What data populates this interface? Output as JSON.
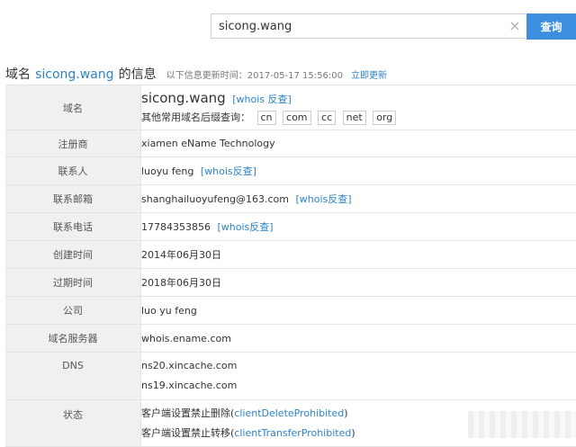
{
  "search": {
    "value": "sicong.wang",
    "clear_icon": "×",
    "button_label": "查询"
  },
  "heading": {
    "prefix": "域名",
    "domain": "sicong.wang",
    "suffix": "的信息",
    "note": "以下信息更新时间：2017-05-17 15:56:00",
    "update_link": "立即更新"
  },
  "rows": {
    "domain": {
      "label": "域名",
      "value": "sicong.wang",
      "link": "[whois 反查]",
      "suffix_prompt": "其他常用域名后缀查询：",
      "suffixes": [
        "cn",
        "com",
        "cc",
        "net",
        "org"
      ]
    },
    "registrar": {
      "label": "注册商",
      "value": "xiamen eName Technology"
    },
    "contact": {
      "label": "联系人",
      "value": "luoyu feng",
      "link": "[whois反查]"
    },
    "email": {
      "label": "联系邮箱",
      "value": "shanghailuoyufeng@163.com",
      "link": "[whois反查]"
    },
    "phone": {
      "label": "联系电话",
      "value": "17784353856",
      "link": "[whois反查]"
    },
    "created": {
      "label": "创建时间",
      "value": "2014年06月30日"
    },
    "expires": {
      "label": "过期时间",
      "value": "2018年06月30日"
    },
    "company": {
      "label": "公司",
      "value": "luo yu feng"
    },
    "nameserver": {
      "label": "域名服务器",
      "value": "whois.ename.com"
    },
    "dns": {
      "label": "DNS",
      "values": [
        "ns20.xincache.com",
        "ns19.xincache.com"
      ]
    },
    "status": {
      "label": "状态",
      "lines": [
        {
          "text": "客户端设置禁止删除(",
          "code": "clientDeleteProhibited",
          "close": ")"
        },
        {
          "text": "客户端设置禁止转移(",
          "code": "clientTransferProhibited",
          "close": ")"
        }
      ]
    }
  }
}
